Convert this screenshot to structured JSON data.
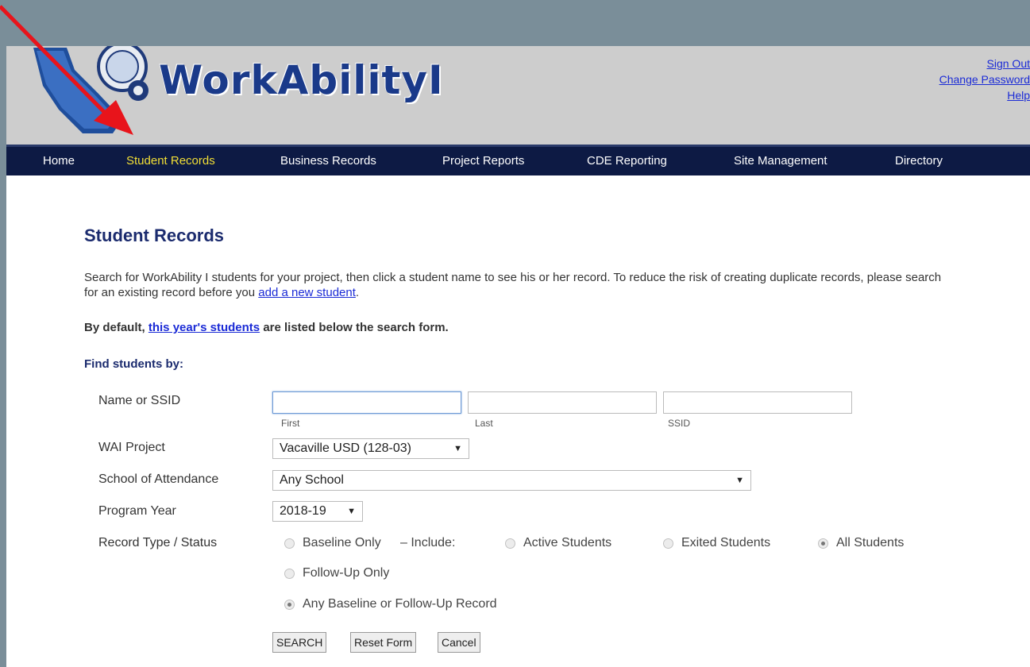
{
  "header": {
    "logo_text": "WorkAbilityI",
    "links": [
      "Sign Out",
      "Change Password",
      "Help"
    ]
  },
  "nav": {
    "items": [
      "Home",
      "Student Records",
      "Business Records",
      "Project Reports",
      "CDE Reporting",
      "Site Management",
      "Directory"
    ],
    "active": "Student Records"
  },
  "main": {
    "title": "Student Records",
    "intro_text": "Search for WorkAbility I students for your project, then click a student name to see his or her record. To reduce the risk of creating duplicate records, please search for an existing record before you",
    "intro_link": "add a new student",
    "default_prefix": "By default,",
    "default_link": "this year's students",
    "default_suffix": "are listed below the search form.",
    "find_label": "Find students by:"
  },
  "form": {
    "name_label": "Name or SSID",
    "first_label": "First",
    "last_label": "Last",
    "ssid_label": "SSID",
    "first_value": "",
    "last_value": "",
    "ssid_value": "",
    "project_label": "WAI Project",
    "project_value": "Vacaville USD (128-03)",
    "school_label": "School of Attendance",
    "school_value": "Any School",
    "year_label": "Program Year",
    "year_value": "2018-19",
    "record_label": "Record Type / Status",
    "baseline_only": "Baseline Only",
    "include_text": "–   Include:",
    "active_students": "Active Students",
    "exited_students": "Exited Students",
    "all_students": "All Students",
    "followup_only": "Follow-Up Only",
    "any_record": "Any Baseline or Follow-Up Record"
  },
  "buttons": {
    "search": "SEARCH",
    "reset": "Reset Form",
    "cancel": "Cancel"
  },
  "colors": {
    "nav_bg": "#0d1a44",
    "nav_active": "#f3df35",
    "heading": "#1b2b6e",
    "link": "#1b2bd6",
    "annotation_arrow": "#e8141b"
  }
}
